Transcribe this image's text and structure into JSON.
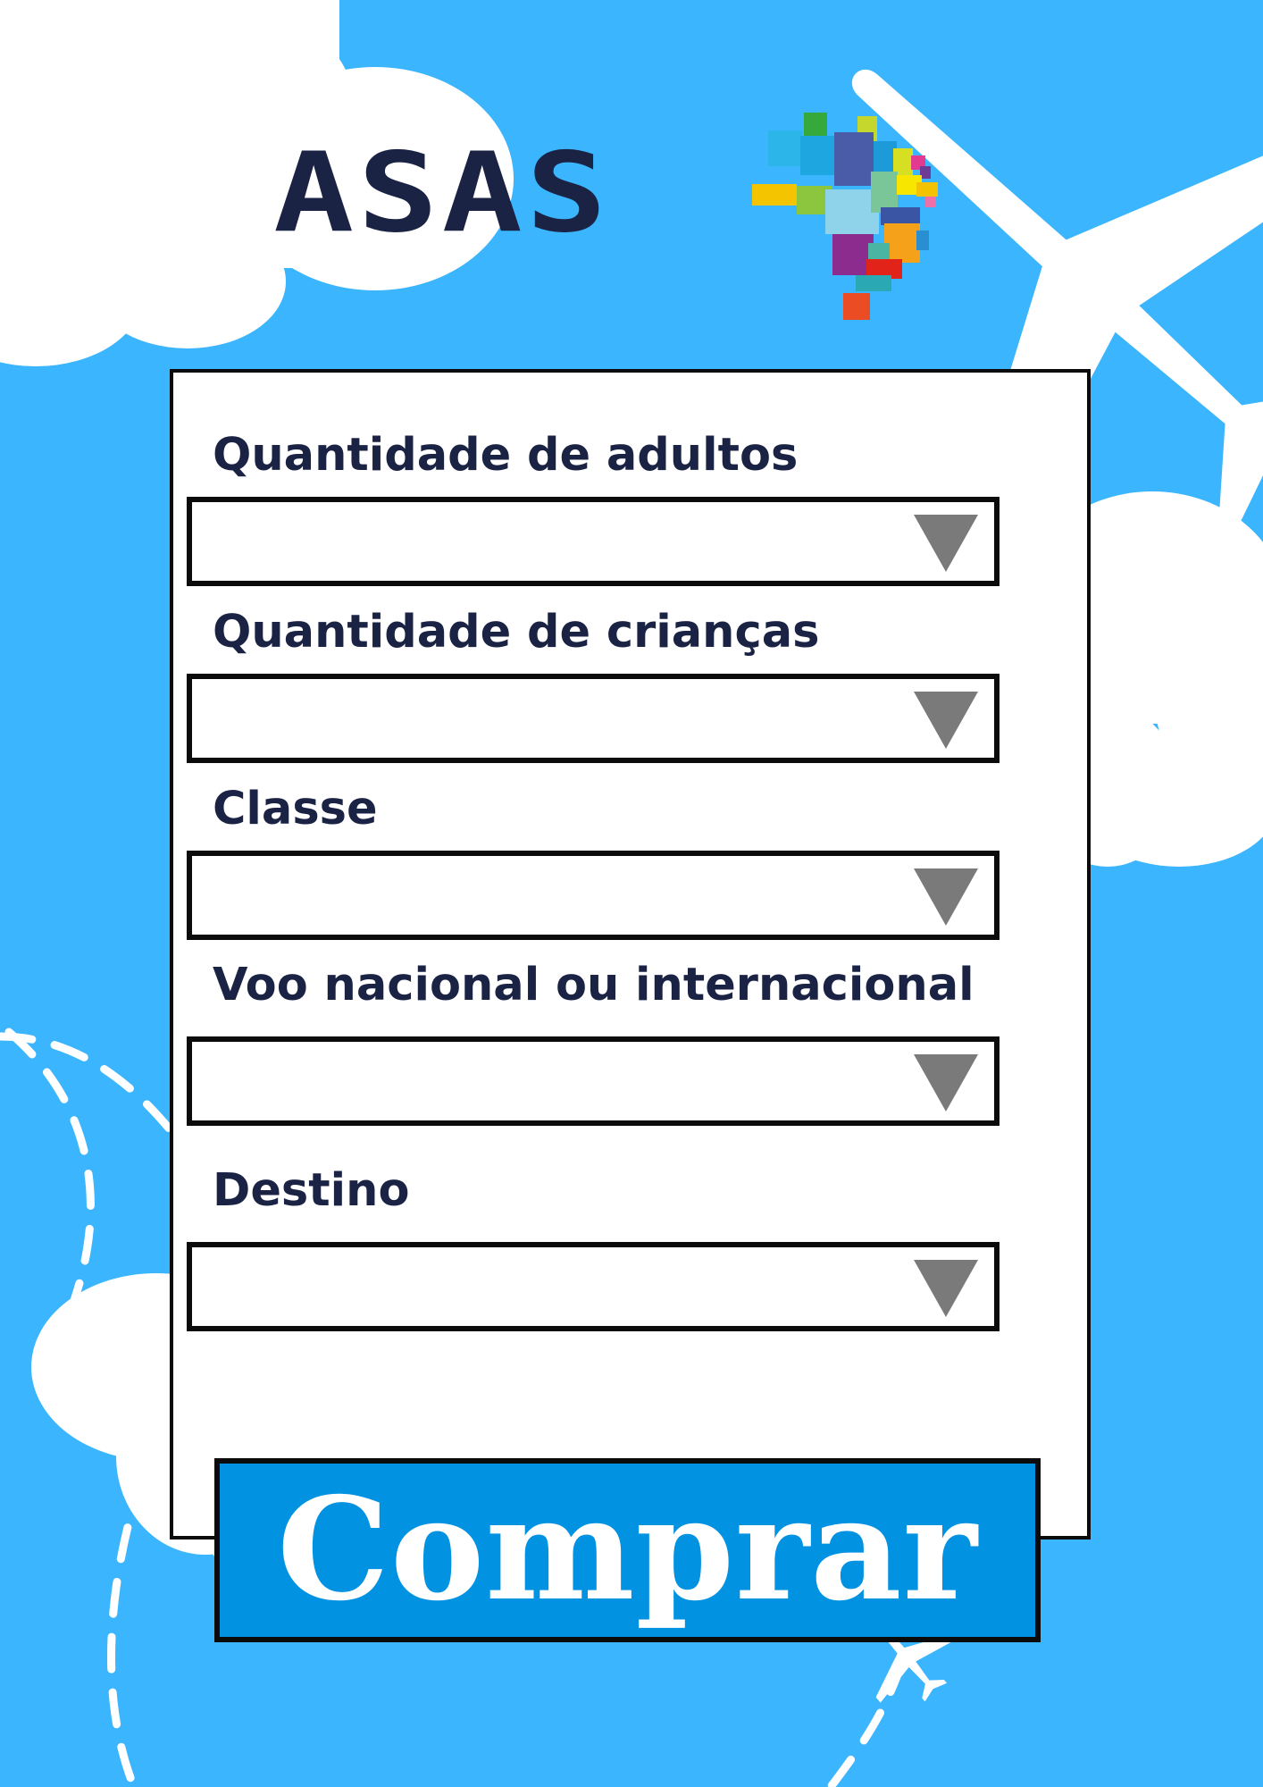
{
  "app": {
    "logo_text": "ASAS"
  },
  "form": {
    "fields": [
      {
        "label": "Quantidade de adultos",
        "value": ""
      },
      {
        "label": "Quantidade de crianças",
        "value": ""
      },
      {
        "label": "Classe",
        "value": ""
      },
      {
        "label": "Voo nacional ou internacional",
        "value": ""
      },
      {
        "label": "Destino",
        "value": ""
      }
    ],
    "submit_label": "Comprar"
  },
  "icons": {
    "logo_mark": "brazil-map-mosaic-icon",
    "airplane": "airplane-icon",
    "dropdown": "triangle-down-icon"
  },
  "colors": {
    "background": "#3bb5fd",
    "cloud": "#ffffff",
    "text_dark": "#1b2345",
    "button": "#0292e2",
    "chevron": "#7a7a7a"
  }
}
